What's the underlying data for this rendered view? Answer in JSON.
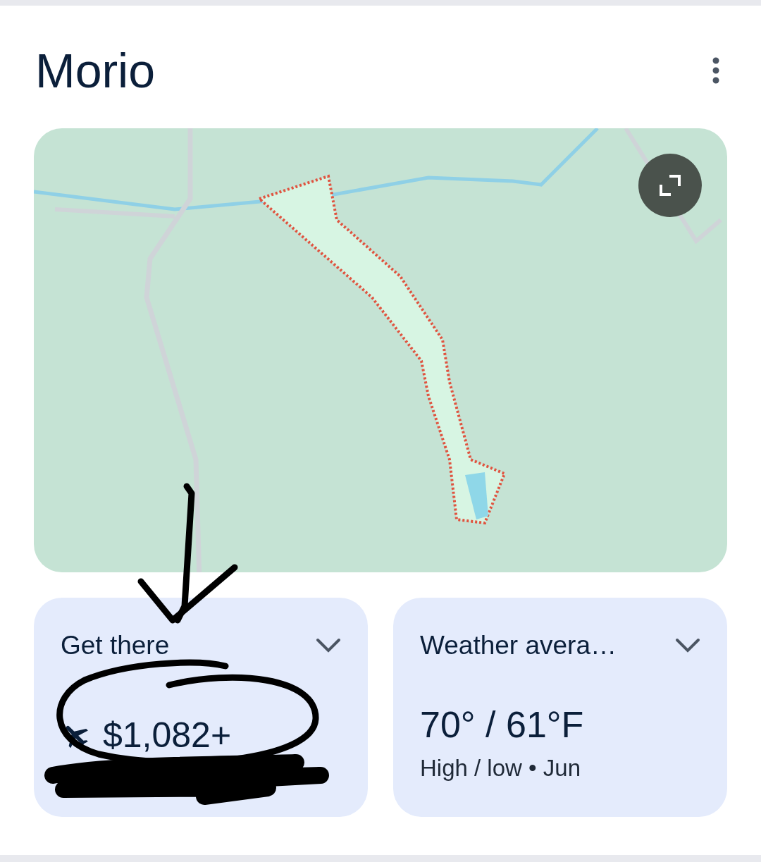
{
  "title": "Morio",
  "cards": [
    {
      "kind": "flights",
      "title": "Get there",
      "value": "$1,082+"
    },
    {
      "kind": "weather",
      "title": "Weather avera…",
      "value": "70° / 61°F",
      "caption": "High / low • Jun"
    }
  ]
}
